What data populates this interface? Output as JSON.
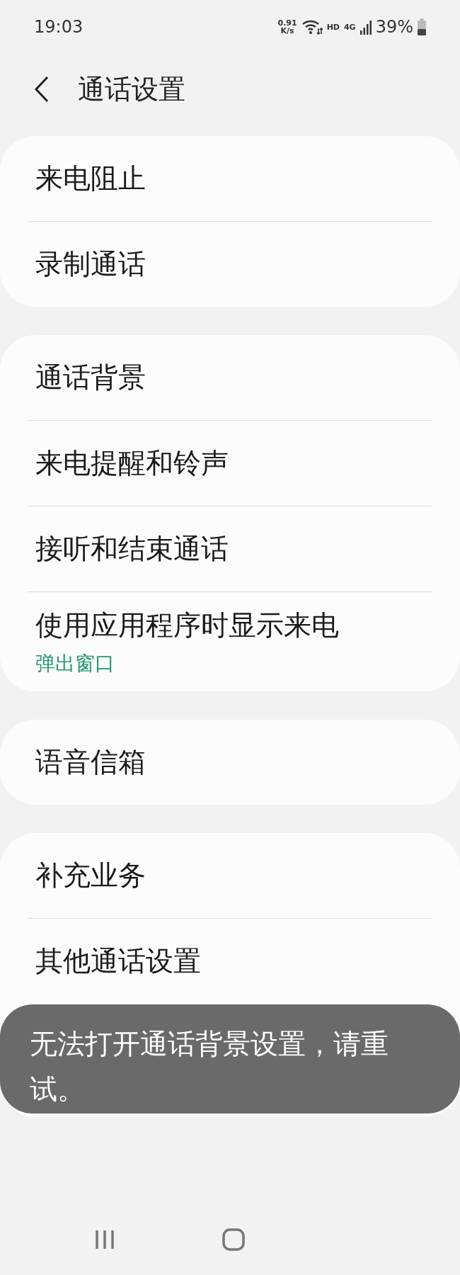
{
  "status_bar": {
    "time": "19:03",
    "net_speed_value": "0.91",
    "net_speed_unit": "K/s",
    "hd": "HD",
    "network": "4G",
    "battery": "39%"
  },
  "header": {
    "title": "通话设置"
  },
  "groups": [
    {
      "items": [
        {
          "label": "来电阻止"
        },
        {
          "label": "录制通话"
        }
      ]
    },
    {
      "items": [
        {
          "label": "通话背景"
        },
        {
          "label": "来电提醒和铃声"
        },
        {
          "label": "接听和结束通话"
        },
        {
          "label": "使用应用程序时显示来电",
          "summary": "弹出窗口"
        }
      ]
    },
    {
      "items": [
        {
          "label": "语音信箱"
        }
      ]
    },
    {
      "items": [
        {
          "label": "补充业务"
        },
        {
          "label": "其他通话设置"
        }
      ]
    }
  ],
  "toast": {
    "message": "无法打开通话背景设置，请重试。"
  }
}
